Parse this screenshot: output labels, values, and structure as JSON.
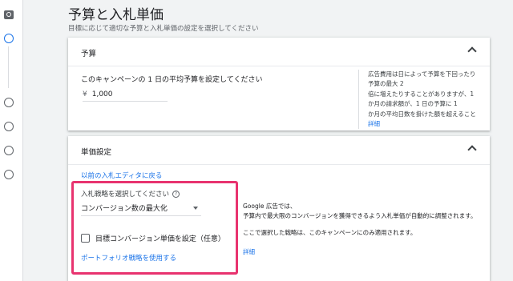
{
  "page": {
    "title": "予算と入札単価",
    "subtitle": "目標に応じて適切な予算と入札単価の設定を選択してください"
  },
  "budget_section": {
    "header": "予算",
    "question": "このキャンペーンの 1 日の平均予算を設定してください",
    "currency": "¥",
    "amount": "1,000",
    "note_lines": [
      "広告費用は日によって予算を下回ったり",
      "予算の最大 2",
      "倍に増えたりすることがありますが、1",
      "か月の請求額が、1 日の予算に 1",
      "か月の平均日数を掛けた額を超えること"
    ],
    "note_link": "詳細"
  },
  "bidding_section": {
    "header": "単価設定",
    "old_editor_link": "以前の入札エディタに戻る",
    "strategy_label": "入札戦略を選択してください",
    "strategy_value": "コンバージョン数の最大化",
    "target_cpa_label": "目標コンバージョン単価を設定（任意）",
    "target_cpa_checked": false,
    "portfolio_link": "ポートフォリオ戦略を使用する",
    "info_lines": [
      "Google 広告では、",
      "予算内で最大限のコンバージョンを獲得できるよう入札単価が自動的に調整されます。"
    ],
    "info_note": "ここで選択した戦略は、このキャンペーンにのみ適用されます。",
    "info_link": "詳細"
  },
  "colors": {
    "accent": "#1a73e8",
    "highlight_box": "#e8336f",
    "background": "#f1f3f4"
  },
  "icons": [
    "search-logo-icon",
    "chevron-up-icon",
    "help-icon",
    "dropdown-caret-icon",
    "checkbox-icon"
  ]
}
